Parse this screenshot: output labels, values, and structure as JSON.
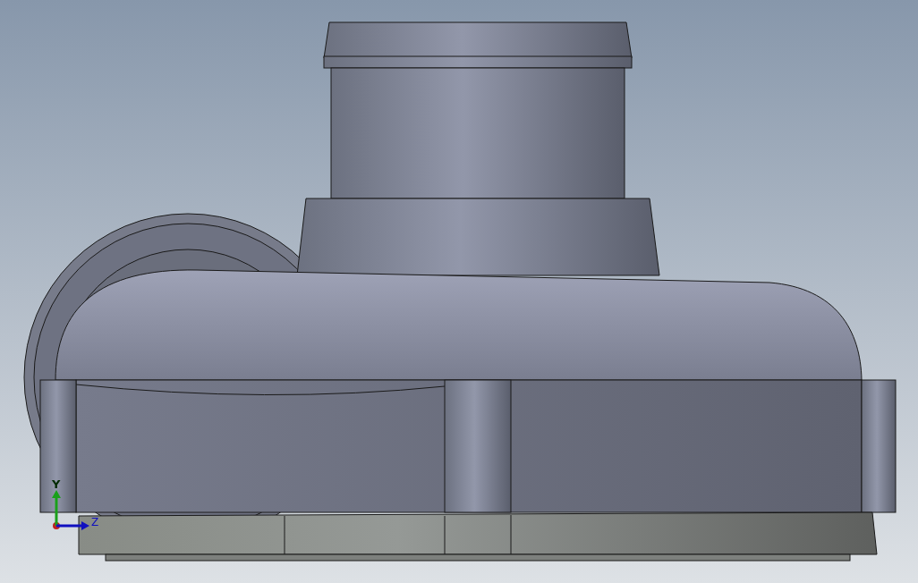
{
  "viewport": {
    "triad": {
      "axes": [
        {
          "label": "Y",
          "color": "#1aa01a"
        },
        {
          "label": "Z",
          "color": "#1010c0"
        }
      ]
    }
  }
}
